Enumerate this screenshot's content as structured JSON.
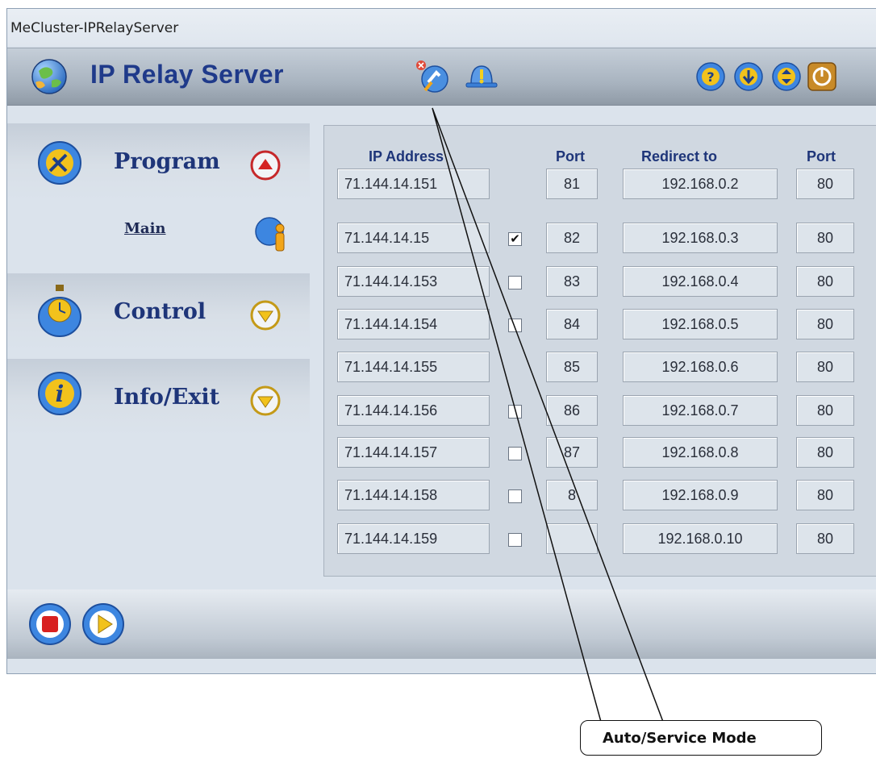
{
  "window": {
    "title": "MeCluster-IPRelayServer",
    "app_title": "IP Relay Server"
  },
  "header_icons": [
    "auto-service-mode-icon",
    "alert-bell-icon",
    "help-icon",
    "download-icon",
    "updown-icon",
    "power-icon"
  ],
  "sidebar": {
    "sections": [
      {
        "label": "Program",
        "icon": "tools-icon",
        "arrow": "up"
      },
      {
        "label": "Control",
        "icon": "stopwatch-icon",
        "arrow": "down"
      },
      {
        "label": "Info/Exit",
        "icon": "info-icon",
        "arrow": "down"
      }
    ],
    "main_link": "Main"
  },
  "table": {
    "headers": {
      "ip": "IP Address",
      "port": "Port",
      "redirect": "Redirect to",
      "port2": "Port"
    },
    "rows": [
      {
        "ip": "71.144.14.151",
        "port": "81",
        "redirect": "192.168.0.2",
        "port2": "80",
        "checkbox": null
      },
      {
        "ip": "71.144.14.15",
        "port": "82",
        "redirect": "192.168.0.3",
        "port2": "80",
        "checkbox": true
      },
      {
        "ip": "71.144.14.153",
        "port": "83",
        "redirect": "192.168.0.4",
        "port2": "80",
        "checkbox": false
      },
      {
        "ip": "71.144.14.154",
        "port": "84",
        "redirect": "192.168.0.5",
        "port2": "80",
        "checkbox": false
      },
      {
        "ip": "71.144.14.155",
        "port": "85",
        "redirect": "192.168.0.6",
        "port2": "80",
        "checkbox": null
      },
      {
        "ip": "71.144.14.156",
        "port": "86",
        "redirect": "192.168.0.7",
        "port2": "80",
        "checkbox": false
      },
      {
        "ip": "71.144.14.157",
        "port": "87",
        "redirect": "192.168.0.8",
        "port2": "80",
        "checkbox": false
      },
      {
        "ip": "71.144.14.158",
        "port": "8",
        "redirect": "192.168.0.9",
        "port2": "80",
        "checkbox": false
      },
      {
        "ip": "71.144.14.159",
        "port": "",
        "redirect": "192.168.0.10",
        "port2": "80",
        "checkbox": false
      }
    ]
  },
  "controls": [
    "stop-icon",
    "play-icon"
  ],
  "callout": {
    "label": "Auto/Service Mode"
  },
  "colors": {
    "accent": "#1f3a8a",
    "label_blue": "#1e3579",
    "panel": "#dbe3ec"
  }
}
